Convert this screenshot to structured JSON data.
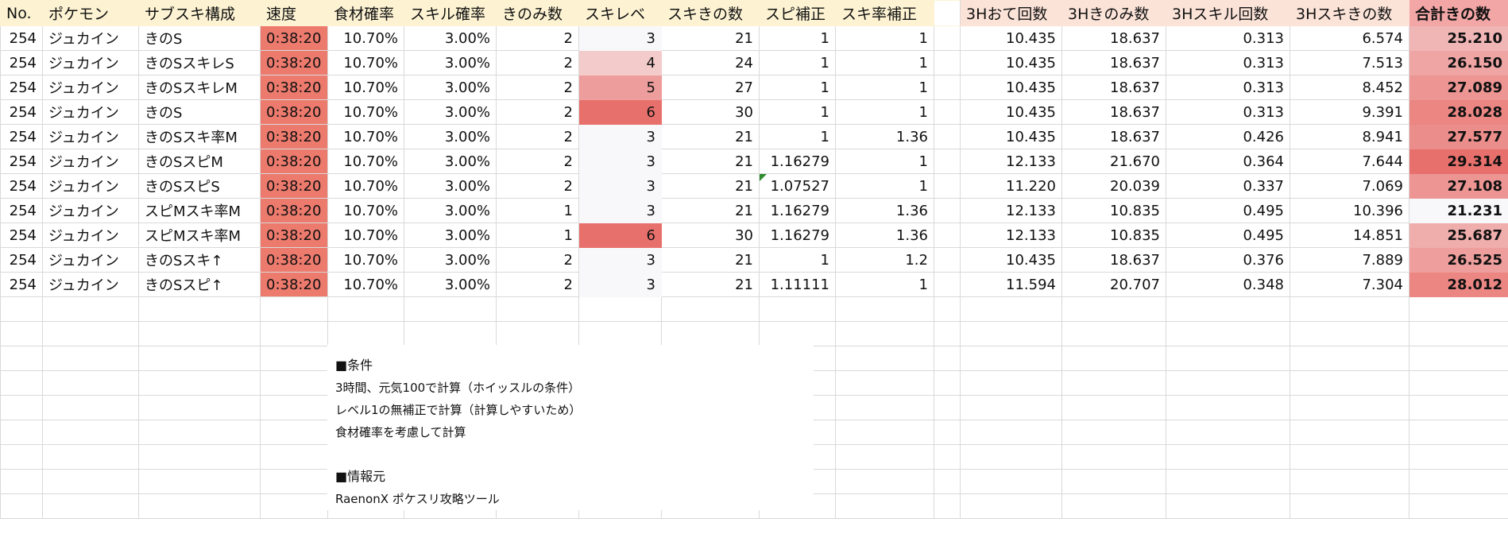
{
  "columns": [
    "No.",
    "ポケモン",
    "サブスキ構成",
    "速度",
    "食材確率",
    "スキル確率",
    "きのみ数",
    "スキレベ",
    "スキきの数",
    "スピ補正",
    "スキ率補正",
    "3Hおて回数",
    "3Hきのみ数",
    "3Hスキル回数",
    "3Hスキきの数",
    "合計きの数"
  ],
  "rows": [
    {
      "no": "254",
      "name": "ジュカイン",
      "build": "きのS",
      "speed": "0:38:20",
      "ing": "10.70%",
      "skill": "3.00%",
      "berry": "2",
      "lv": "3",
      "skb": "21",
      "spd": "1",
      "skr": "1",
      "h1": "10.435",
      "h2": "18.637",
      "h3": "0.313",
      "h4": "6.574",
      "total": "25.210"
    },
    {
      "no": "254",
      "name": "ジュカイン",
      "build": "きのSスキレS",
      "speed": "0:38:20",
      "ing": "10.70%",
      "skill": "3.00%",
      "berry": "2",
      "lv": "4",
      "skb": "24",
      "spd": "1",
      "skr": "1",
      "h1": "10.435",
      "h2": "18.637",
      "h3": "0.313",
      "h4": "7.513",
      "total": "26.150"
    },
    {
      "no": "254",
      "name": "ジュカイン",
      "build": "きのSスキレM",
      "speed": "0:38:20",
      "ing": "10.70%",
      "skill": "3.00%",
      "berry": "2",
      "lv": "5",
      "skb": "27",
      "spd": "1",
      "skr": "1",
      "h1": "10.435",
      "h2": "18.637",
      "h3": "0.313",
      "h4": "8.452",
      "total": "27.089"
    },
    {
      "no": "254",
      "name": "ジュカイン",
      "build": "きのS",
      "speed": "0:38:20",
      "ing": "10.70%",
      "skill": "3.00%",
      "berry": "2",
      "lv": "6",
      "skb": "30",
      "spd": "1",
      "skr": "1",
      "h1": "10.435",
      "h2": "18.637",
      "h3": "0.313",
      "h4": "9.391",
      "total": "28.028"
    },
    {
      "no": "254",
      "name": "ジュカイン",
      "build": "きのSスキ率M",
      "speed": "0:38:20",
      "ing": "10.70%",
      "skill": "3.00%",
      "berry": "2",
      "lv": "3",
      "skb": "21",
      "spd": "1",
      "skr": "1.36",
      "h1": "10.435",
      "h2": "18.637",
      "h3": "0.426",
      "h4": "8.941",
      "total": "27.577"
    },
    {
      "no": "254",
      "name": "ジュカイン",
      "build": "きのSスピM",
      "speed": "0:38:20",
      "ing": "10.70%",
      "skill": "3.00%",
      "berry": "2",
      "lv": "3",
      "skb": "21",
      "spd": "1.16279",
      "skr": "1",
      "h1": "12.133",
      "h2": "21.670",
      "h3": "0.364",
      "h4": "7.644",
      "total": "29.314"
    },
    {
      "no": "254",
      "name": "ジュカイン",
      "build": "きのSスピS",
      "speed": "0:38:20",
      "ing": "10.70%",
      "skill": "3.00%",
      "berry": "2",
      "lv": "3",
      "skb": "21",
      "spd": "1.07527",
      "skr": "1",
      "h1": "11.220",
      "h2": "20.039",
      "h3": "0.337",
      "h4": "7.069",
      "total": "27.108"
    },
    {
      "no": "254",
      "name": "ジュカイン",
      "build": "スピMスキ率M",
      "speed": "0:38:20",
      "ing": "10.70%",
      "skill": "3.00%",
      "berry": "1",
      "lv": "3",
      "skb": "21",
      "spd": "1.16279",
      "skr": "1.36",
      "h1": "12.133",
      "h2": "10.835",
      "h3": "0.495",
      "h4": "10.396",
      "total": "21.231"
    },
    {
      "no": "254",
      "name": "ジュカイン",
      "build": "スピMスキ率M",
      "speed": "0:38:20",
      "ing": "10.70%",
      "skill": "3.00%",
      "berry": "1",
      "lv": "6",
      "skb": "30",
      "spd": "1.16279",
      "skr": "1.36",
      "h1": "12.133",
      "h2": "10.835",
      "h3": "0.495",
      "h4": "14.851",
      "total": "25.687"
    },
    {
      "no": "254",
      "name": "ジュカイン",
      "build": "きのSスキ↑",
      "speed": "0:38:20",
      "ing": "10.70%",
      "skill": "3.00%",
      "berry": "2",
      "lv": "3",
      "skb": "21",
      "spd": "1",
      "skr": "1.2",
      "h1": "10.435",
      "h2": "18.637",
      "h3": "0.376",
      "h4": "7.889",
      "total": "26.525"
    },
    {
      "no": "254",
      "name": "ジュカイン",
      "build": "きのSスピ↑",
      "speed": "0:38:20",
      "ing": "10.70%",
      "skill": "3.00%",
      "berry": "2",
      "lv": "3",
      "skb": "21",
      "spd": "1.11111",
      "skr": "1",
      "h1": "11.594",
      "h2": "20.707",
      "h3": "0.348",
      "h4": "7.304",
      "total": "28.012"
    }
  ],
  "notes": {
    "cond_title": "■条件",
    "cond1": "3時間、元気100で計算（ホイッスルの条件）",
    "cond2": "レベル1の無補正で計算（計算しやすいため）",
    "cond3": "食材確率を考慮して計算",
    "src_title": "■情報元",
    "src1": "RaenonX ポケスリ攻略ツール"
  },
  "colors": {
    "header_left": "#fdf3d3",
    "header_right": "#fbe3d8",
    "speed_fill": "#ec7a6d",
    "scale_low": "#f8f8fb",
    "scale_high": "#e8706c",
    "grid": "#d9d9d9"
  }
}
